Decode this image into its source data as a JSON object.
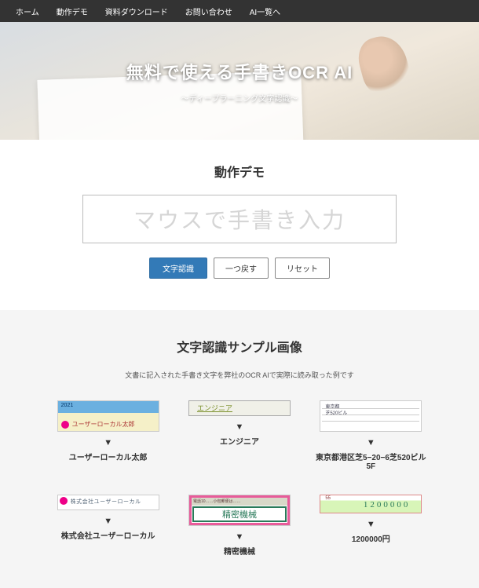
{
  "nav": {
    "items": [
      {
        "label": "ホーム"
      },
      {
        "label": "動作デモ"
      },
      {
        "label": "資料ダウンロード"
      },
      {
        "label": "お問い合わせ"
      },
      {
        "label": "AI一覧へ"
      }
    ]
  },
  "hero": {
    "title": "無料で使える手書きOCR AI",
    "subtitle": "～ディープラーニング文字認識～"
  },
  "demo": {
    "heading": "動作デモ",
    "canvas_placeholder": "マウスで手書き入力",
    "buttons": {
      "recognize": "文字認識",
      "undo": "一つ戻す",
      "reset": "リセット"
    }
  },
  "samples": {
    "heading": "文字認識サンプル画像",
    "description": "文書に記入された手書き文字を弊社のOCR AIで実際に読み取った例です",
    "arrow": "▼",
    "items": [
      {
        "caption": "ユーザーローカル太郎"
      },
      {
        "caption": "エンジニア"
      },
      {
        "caption": "東京都港区芝5−20−6芝520ビル5F"
      },
      {
        "caption": "株式会社ユーザーローカル"
      },
      {
        "caption": "精密機械"
      },
      {
        "caption": "1200000円"
      }
    ],
    "thumb_text": {
      "t3_line1": "東京都",
      "t3_line2": "芝520ビル",
      "t5_top": "電話10……小包郵便は……",
      "t5_bot": "精密機械"
    }
  }
}
